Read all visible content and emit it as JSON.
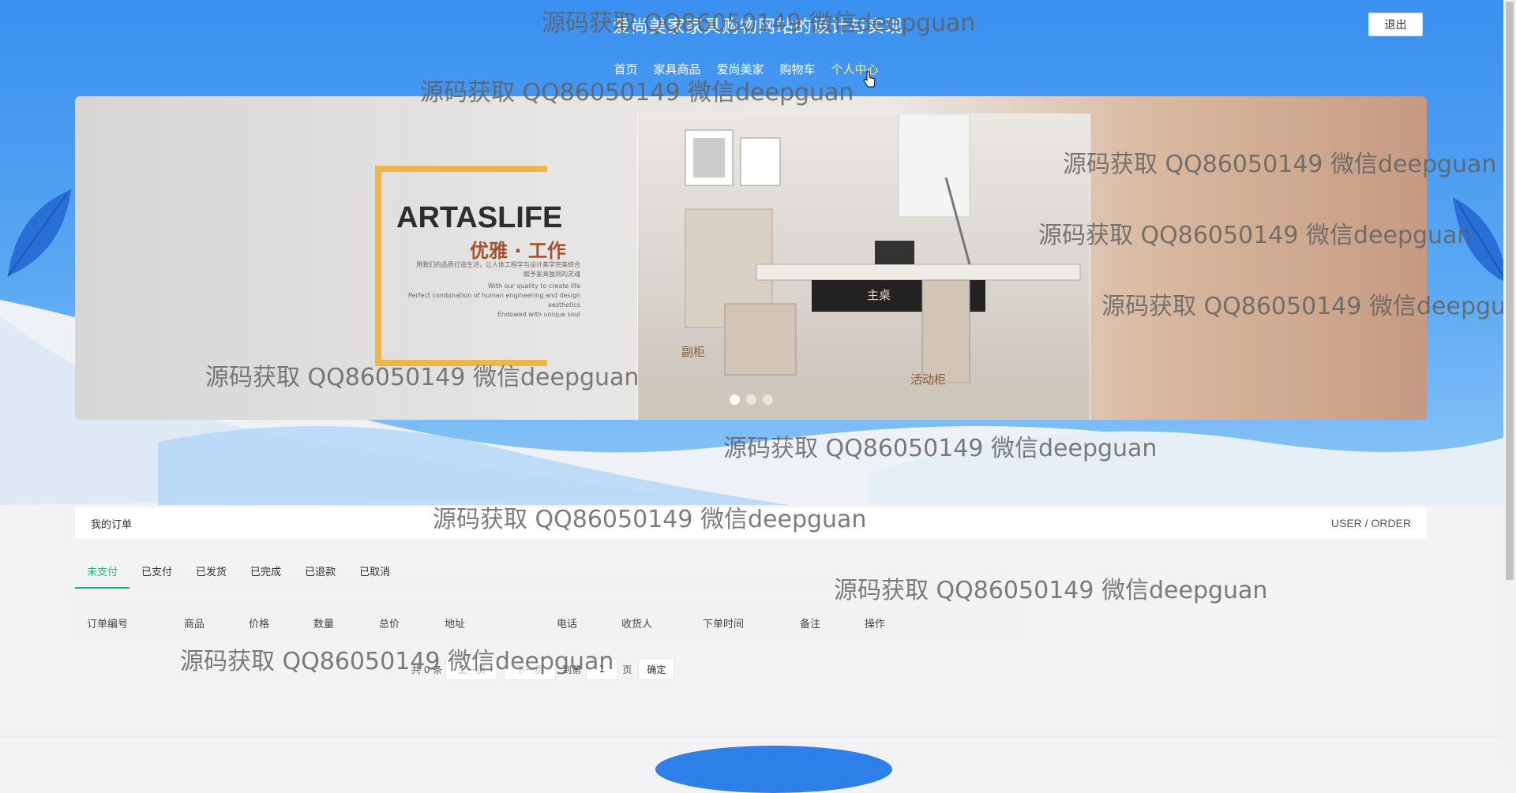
{
  "header": {
    "title": "爱尚美家家具购物网站的设计与实现",
    "logout_label": "退出"
  },
  "nav": {
    "items": [
      "首页",
      "家具商品",
      "爱尚美家",
      "购物车",
      "个人中心"
    ],
    "active_index": 4
  },
  "banner": {
    "brand_name": "ARTASLIFE",
    "brand_sub": "优雅 · 工作",
    "brand_lines": [
      "用我们的品质打造生活，让人体工程学与设计美学完美结合",
      "赋予家具独到的灵魂",
      "With our quality to create life",
      "Perfect combination of human engineering and design aesthetics",
      "Endowed with unique soul"
    ],
    "labels": [
      "主桌",
      "副柜",
      "活动柜"
    ],
    "slides_count": 3,
    "active_slide": 0
  },
  "watermark_text": "源码获取 QQ86050149 微信deepguan",
  "orders": {
    "section_title": "我的订单",
    "section_en": "USER / ORDER",
    "tabs": [
      "未支付",
      "已支付",
      "已发货",
      "已完成",
      "已退款",
      "已取消"
    ],
    "active_tab": 0,
    "columns": [
      "订单编号",
      "商品",
      "价格",
      "数量",
      "总价",
      "地址",
      "电话",
      "收货人",
      "下单时间",
      "备注",
      "操作"
    ]
  },
  "pager": {
    "total": "共 0 条",
    "prev": "上一页",
    "next": "下一页",
    "goto": "到第",
    "page_value": "1",
    "page_unit": "页",
    "confirm": "确定"
  },
  "colors": {
    "accent_green": "#19b87a",
    "nav_active": "#ffe96b",
    "header_blue": "#3a8ff0"
  }
}
